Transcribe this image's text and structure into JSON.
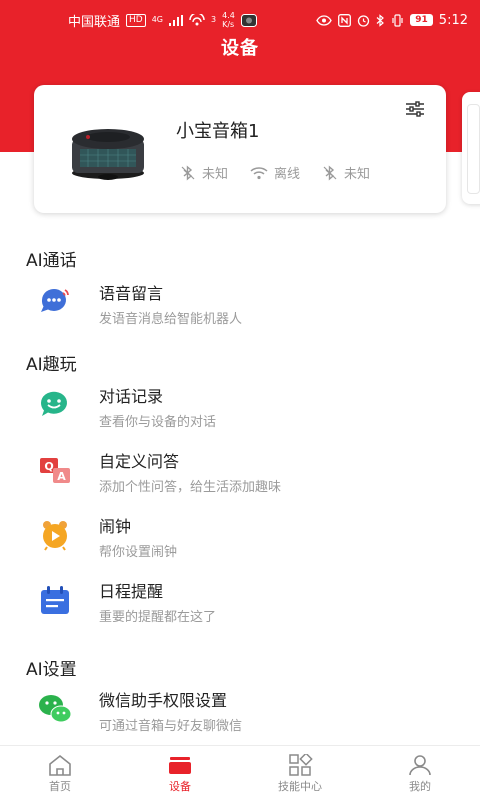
{
  "status_bar": {
    "carrier": "中国联通",
    "hd": "HD",
    "network": "4G",
    "hotspot_level": "3",
    "speed_value": "4.4",
    "speed_unit": "K/s",
    "battery": "91",
    "time": "5:12"
  },
  "header": {
    "title": "设备"
  },
  "device_card": {
    "name": "小宝音箱1",
    "statuses": [
      {
        "icon": "bluetooth-off-icon",
        "label": "未知"
      },
      {
        "icon": "wifi-icon",
        "label": "离线"
      },
      {
        "icon": "bluetooth-off-icon",
        "label": "未知"
      }
    ]
  },
  "sections": [
    {
      "title": "AI通话",
      "items": [
        {
          "icon": "voice-message-icon",
          "title": "语音留言",
          "subtitle": "发语音消息给智能机器人"
        }
      ]
    },
    {
      "title": "AI趣玩",
      "items": [
        {
          "icon": "chat-history-icon",
          "title": "对话记录",
          "subtitle": "查看你与设备的对话"
        },
        {
          "icon": "qa-icon",
          "title": "自定义问答",
          "subtitle": "添加个性问答，给生活添加趣味"
        },
        {
          "icon": "alarm-clock-icon",
          "title": "闹钟",
          "subtitle": "帮你设置闹钟"
        },
        {
          "icon": "calendar-icon",
          "title": "日程提醒",
          "subtitle": "重要的提醒都在这了"
        }
      ]
    },
    {
      "title": "AI设置",
      "items": [
        {
          "icon": "wechat-icon",
          "title": "微信助手权限设置",
          "subtitle": "可通过音箱与好友聊微信"
        }
      ]
    }
  ],
  "bottom_nav": [
    {
      "icon": "home-icon",
      "label": "首页"
    },
    {
      "icon": "device-icon",
      "label": "设备",
      "active": true
    },
    {
      "icon": "skills-icon",
      "label": "技能中心"
    },
    {
      "icon": "profile-icon",
      "label": "我的"
    }
  ],
  "colors": {
    "brand_red": "#e8222a",
    "secondary_text": "#9b9b9b"
  }
}
